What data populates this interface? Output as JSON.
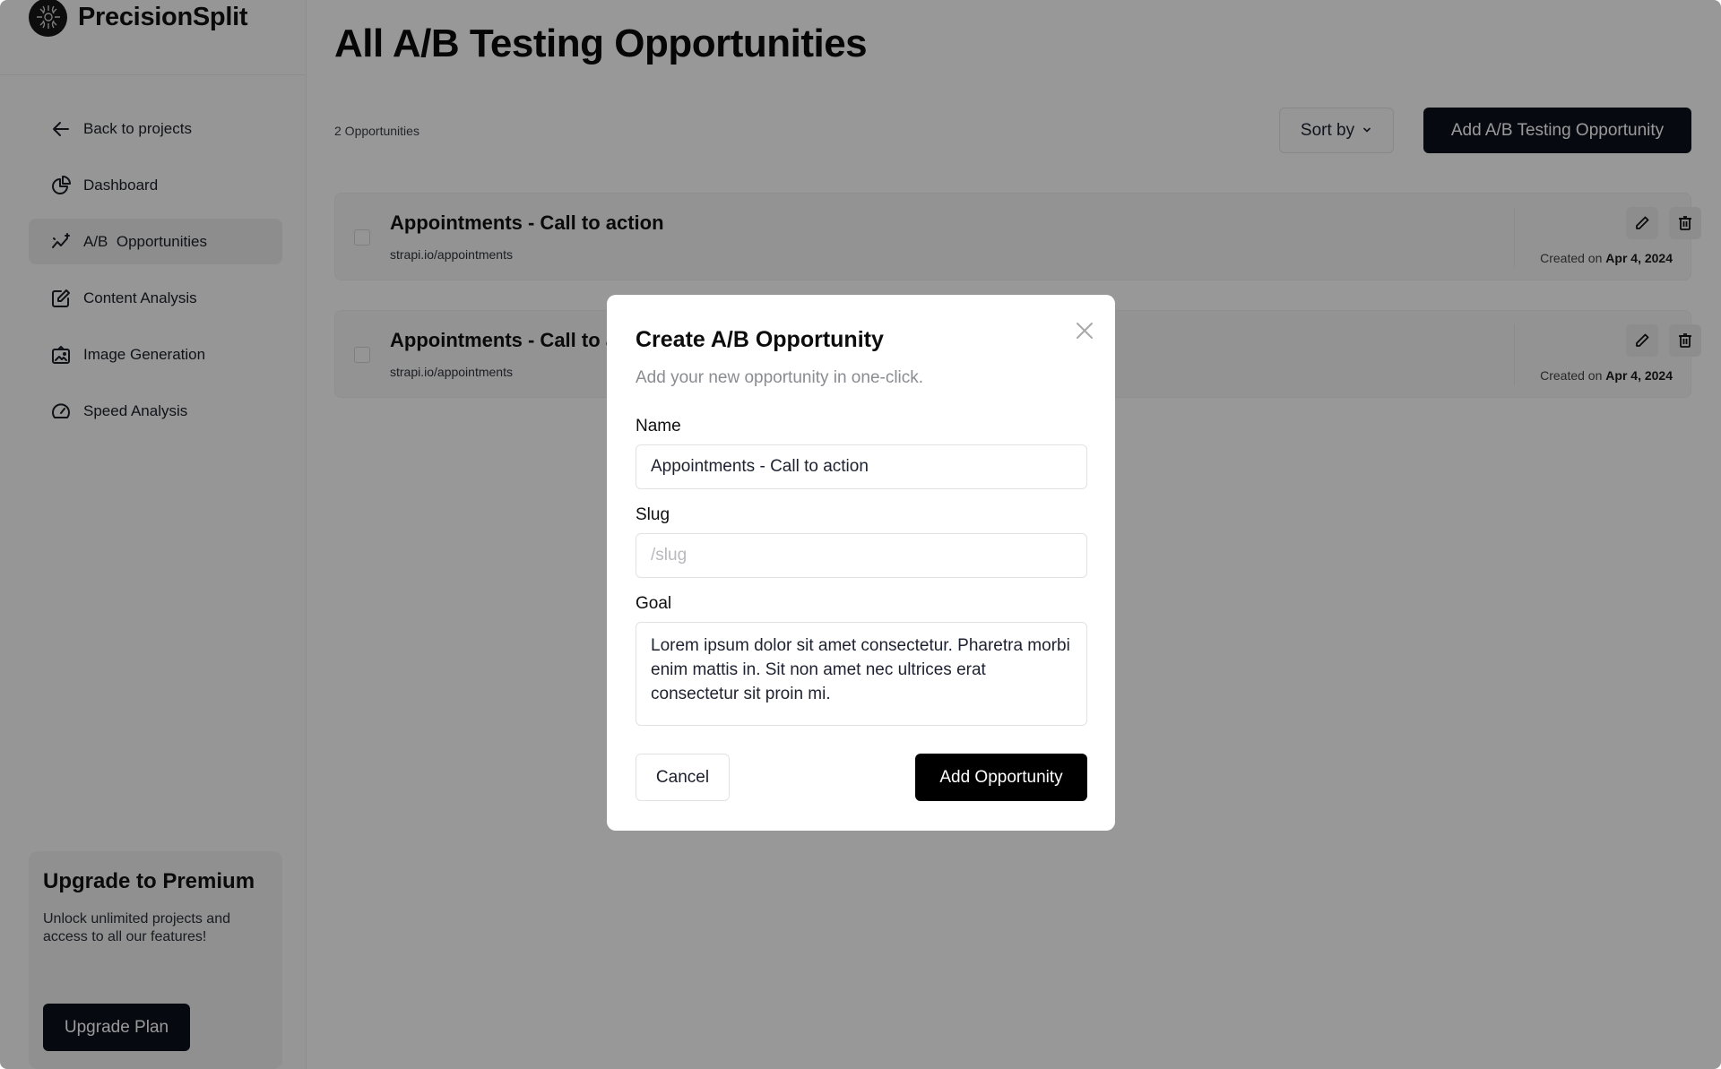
{
  "app": {
    "name": "PrecisionSplit"
  },
  "sidebar": {
    "items": [
      {
        "label": "Back to projects",
        "icon": "arrow-left-icon",
        "active": false
      },
      {
        "label": "Dashboard",
        "icon": "pie-chart-icon",
        "active": false
      },
      {
        "label": "A/B  Opportunities",
        "icon": "trend-sparkle-icon",
        "active": true
      },
      {
        "label": "Content Analysis",
        "icon": "edit-square-icon",
        "active": false
      },
      {
        "label": "Image Generation",
        "icon": "image-frame-icon",
        "active": false
      },
      {
        "label": "Speed Analysis",
        "icon": "gauge-icon",
        "active": false
      }
    ],
    "premium": {
      "title": "Upgrade to Premium",
      "description": "Unlock unlimited projects and access to all our features!",
      "button_label": "Upgrade Plan"
    }
  },
  "main": {
    "title": "All A/B Testing Opportunities",
    "count_label": "2 Opportunities",
    "sort_label": "Sort by",
    "add_label": "Add A/B Testing Opportunity",
    "opportunities": [
      {
        "title": "Appointments - Call to action",
        "url": "strapi.io/appointments",
        "created_prefix": "Created on",
        "created_date": "Apr 4, 2024"
      },
      {
        "title": "Appointments - Call to action",
        "url": "strapi.io/appointments",
        "created_prefix": "Created on",
        "created_date": "Apr 4, 2024"
      }
    ]
  },
  "modal": {
    "title": "Create A/B Opportunity",
    "subtitle": "Add your new opportunity in one-click.",
    "name_label": "Name",
    "name_value": "Appointments - Call to action",
    "slug_label": "Slug",
    "slug_placeholder": "/slug",
    "slug_value": "",
    "goal_label": "Goal",
    "goal_value": "Lorem ipsum dolor sit amet consectetur. Pharetra morbi enim mattis in. Sit non amet nec ultrices erat consectetur sit proin mi.",
    "cancel_label": "Cancel",
    "submit_label": "Add Opportunity"
  },
  "colors": {
    "primary_button": "#0b0f1c",
    "submit_button": "#000000",
    "active_nav_bg": "#ececec",
    "overlay": "rgba(0,0,0,0.4)"
  }
}
